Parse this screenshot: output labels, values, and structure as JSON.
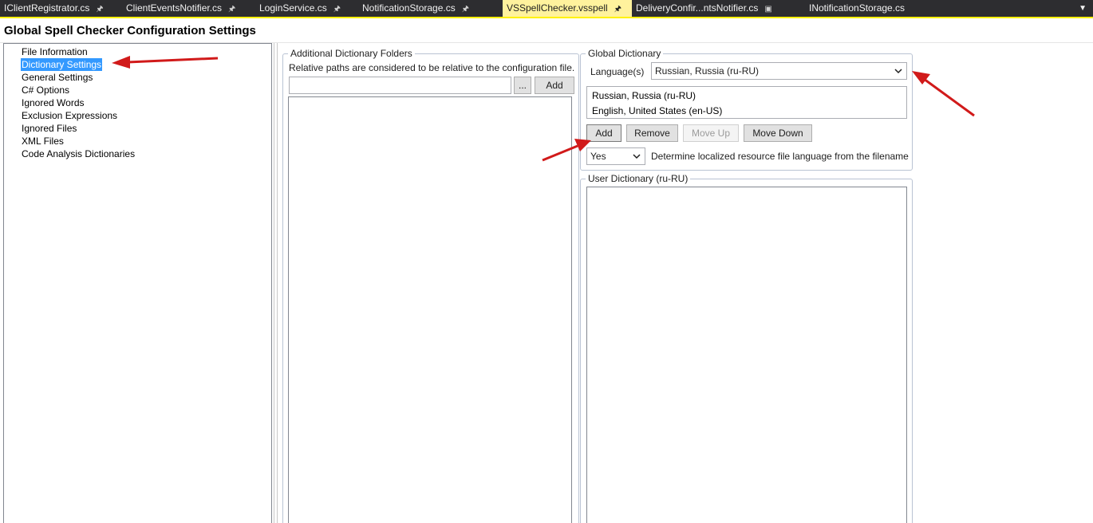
{
  "tabs": [
    {
      "label": "IClientRegistrator.cs",
      "pinned": true
    },
    {
      "label": "ClientEventsNotifier.cs",
      "pinned": true
    },
    {
      "label": "LoginService.cs",
      "pinned": true
    },
    {
      "label": "NotificationStorage.cs",
      "pinned": true
    },
    {
      "label": "VSSpellChecker.vsspell",
      "pinned": true,
      "active": true
    },
    {
      "label": "DeliveryConfir...ntsNotifier.cs",
      "pinned": false,
      "saved_icon": true
    },
    {
      "label": "INotificationStorage.cs",
      "pinned": false
    }
  ],
  "page": {
    "title": "Global Spell Checker Configuration Settings"
  },
  "tree": {
    "items": [
      {
        "label": "File Information"
      },
      {
        "label": "Dictionary Settings",
        "selected": true
      },
      {
        "label": "General Settings"
      },
      {
        "label": "C# Options"
      },
      {
        "label": "Ignored Words"
      },
      {
        "label": "Exclusion Expressions"
      },
      {
        "label": "Ignored Files"
      },
      {
        "label": "XML Files"
      },
      {
        "label": "Code Analysis Dictionaries"
      }
    ]
  },
  "additional_folders": {
    "legend": "Additional Dictionary Folders",
    "note": "Relative paths are considered to be relative to the configuration file.",
    "path_value": "",
    "browse_label": "...",
    "add_label": "Add"
  },
  "global_dictionary": {
    "legend": "Global Dictionary",
    "language_label": "Language(s)",
    "language_selected": "Russian, Russia (ru-RU)",
    "languages": [
      "Russian, Russia (ru-RU)",
      "English, United States (en-US)"
    ],
    "add_label": "Add",
    "remove_label": "Remove",
    "move_up_label": "Move Up",
    "move_down_label": "Move Down",
    "detect_value": "Yes",
    "detect_label": "Determine localized resource file language from the filename"
  },
  "user_dictionary": {
    "legend": "User Dictionary (ru-RU)"
  },
  "colors": {
    "selection": "#3399ff",
    "active_tab": "#fff29d",
    "tabbar": "#2d2d30",
    "annotation_arrow": "#d11a1a"
  },
  "icons": {
    "pin": "pin-icon",
    "chevron": "chevron-down-icon",
    "overflow": "tab-overflow-icon"
  }
}
